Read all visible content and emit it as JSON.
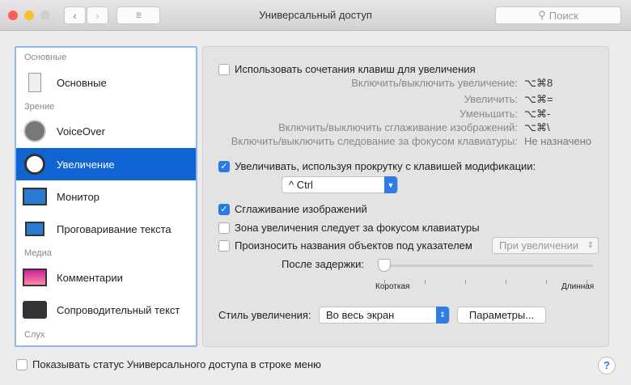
{
  "window": {
    "title": "Универсальный доступ",
    "search_placeholder": "Поиск"
  },
  "sidebar": {
    "sections": [
      "Основные",
      "Зрение",
      "Медиа",
      "Слух"
    ],
    "items": [
      {
        "label": "Основные"
      },
      {
        "label": "VoiceOver"
      },
      {
        "label": "Увеличение"
      },
      {
        "label": "Монитор"
      },
      {
        "label": "Проговаривание текста"
      },
      {
        "label": "Комментарии"
      },
      {
        "label": "Сопроводительный текст"
      }
    ],
    "selected": "Увеличение"
  },
  "zoom": {
    "use_shortcuts": {
      "label": "Использовать сочетания клавиш для увеличения",
      "checked": false
    },
    "shortcuts": [
      {
        "label": "Включить/выключить увеличение:",
        "key": "⌥⌘8"
      },
      {
        "label": "Увеличить:",
        "key": "⌥⌘="
      },
      {
        "label": "Уменьшить:",
        "key": "⌥⌘-"
      },
      {
        "label": "Включить/выключить сглаживание изображений:",
        "key": "⌥⌘\\"
      },
      {
        "label": "Включить/выключить следование за фокусом клавиатуры:",
        "key": "Не назначено"
      }
    ],
    "scroll_zoom": {
      "label": "Увеличивать, используя прокрутку с клавишей модификации:",
      "checked": true,
      "modifier": "^ Ctrl"
    },
    "smooth": {
      "label": "Сглаживание изображений",
      "checked": true
    },
    "follow_focus": {
      "label": "Зона увеличения следует за фокусом клавиатуры",
      "checked": false
    },
    "speak": {
      "label": "Произносить названия объектов под указателем",
      "checked": false,
      "when": "При увеличении"
    },
    "delay": {
      "label": "После задержки:",
      "min_label": "Короткая",
      "max_label": "Длинная",
      "value": 0
    },
    "style": {
      "label": "Стиль увеличения:",
      "value": "Во весь экран",
      "options_button": "Параметры..."
    }
  },
  "footer": {
    "status_label": "Показывать статус Универсального доступа в строке меню",
    "checked": false,
    "help": "?"
  }
}
